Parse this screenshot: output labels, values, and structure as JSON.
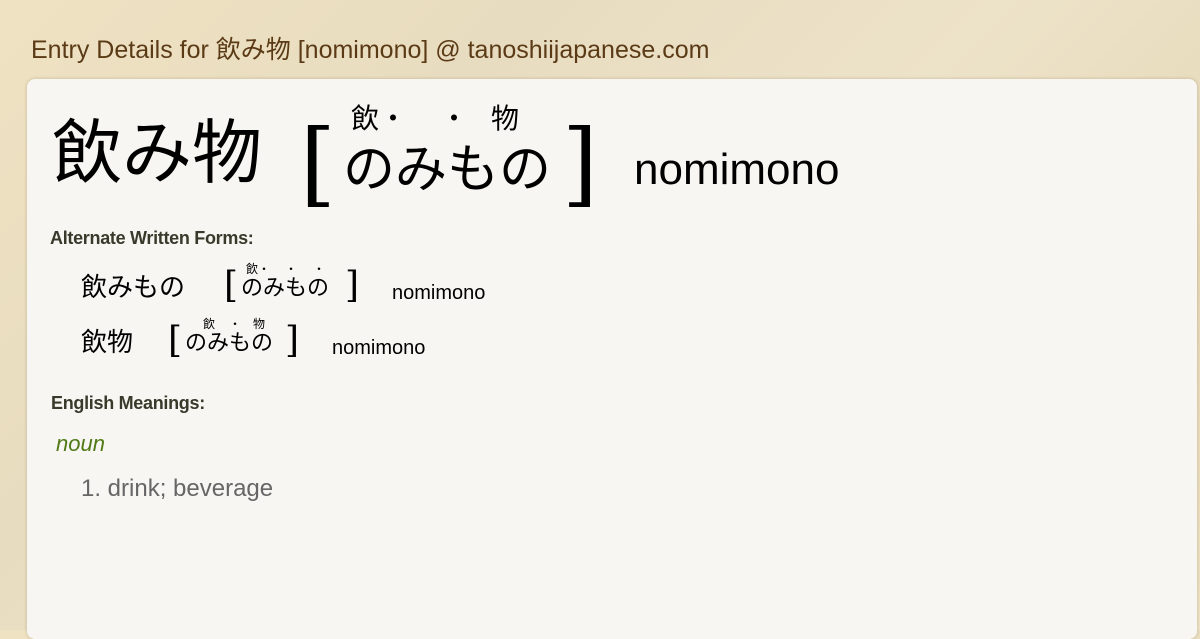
{
  "page": {
    "title": "Entry Details for 飲み物 [nomimono] @ tanoshiijapanese.com"
  },
  "entry": {
    "kanji": "飲み物",
    "bracket_open": "[",
    "bracket_close": "]",
    "furigana": [
      "飲・",
      "・",
      "物"
    ],
    "kana": "のみもの",
    "romaji": "nomimono"
  },
  "alternate_forms": {
    "label": "Alternate Written Forms:",
    "items": [
      {
        "kanji": "飲みもの",
        "furigana": [
          "飲・",
          "・",
          "・"
        ],
        "kana": "のみもの",
        "romaji": "nomimono"
      },
      {
        "kanji": "飲物",
        "furigana": [
          "飲",
          "・",
          "物"
        ],
        "kana": "のみもの",
        "romaji": "nomimono"
      }
    ]
  },
  "meanings": {
    "label": "English Meanings:",
    "part_of_speech": "noun",
    "definitions": [
      "1. drink; beverage"
    ]
  }
}
